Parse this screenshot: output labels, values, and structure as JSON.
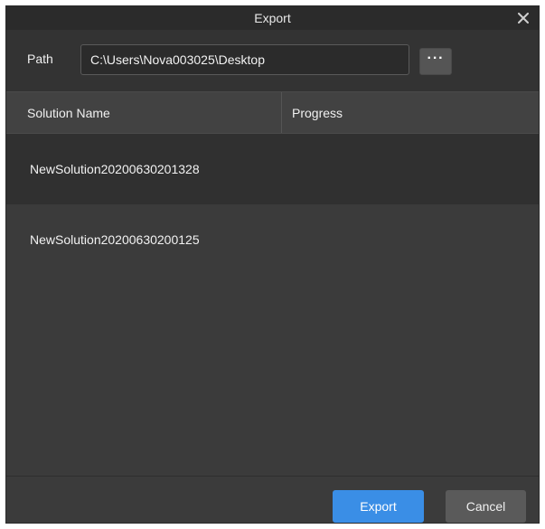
{
  "dialog": {
    "title": "Export",
    "close_icon": "close-icon"
  },
  "path": {
    "label": "Path",
    "value": "C:\\Users\\Nova003025\\Desktop",
    "browse_icon": "ellipsis-icon",
    "browse_label": "···"
  },
  "table": {
    "columns": [
      "Solution Name",
      "Progress"
    ],
    "rows": [
      {
        "name": "NewSolution20200630201328",
        "progress": "",
        "selected": true
      },
      {
        "name": "NewSolution20200630200125",
        "progress": "",
        "selected": false
      }
    ]
  },
  "footer": {
    "export_label": "Export",
    "cancel_label": "Cancel"
  },
  "colors": {
    "accent": "#3a8ee6",
    "background": "#3b3b3b",
    "title_bar": "#2b2b2b",
    "selected_row": "#303030"
  }
}
